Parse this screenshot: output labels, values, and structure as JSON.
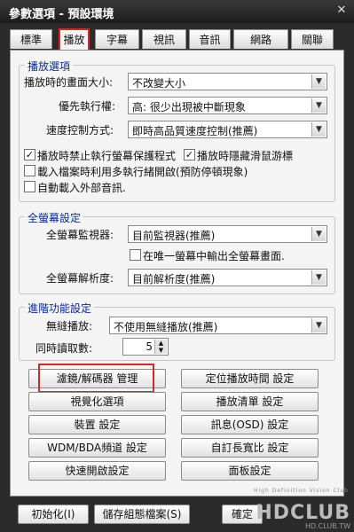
{
  "window": {
    "title": "參數選項 - 預設環境",
    "close_glyph": "✕"
  },
  "tabs": [
    "標準",
    "播放",
    "字幕",
    "視訊",
    "音訊",
    "網路",
    "關聯"
  ],
  "playback_options": {
    "legend": "播放選項",
    "screen_size_label": "播放時的畫面大小:",
    "screen_size_value": "不改變大小",
    "priority_label": "優先執行權:",
    "priority_value": "高: 很少出現被中斷現象",
    "speed_label": "速度控制方式:",
    "speed_value": "即時高品質速度控制(推薦)",
    "checkboxes": [
      {
        "label": "播放時禁止執行螢幕保護程式",
        "checked": true
      },
      {
        "label": "播放時隱藏滑鼠游標",
        "checked": true
      },
      {
        "label": "載入檔案時利用多執行緒開啟(預防停頓現象)",
        "checked": false
      },
      {
        "label": "自動載入外部音訊.",
        "checked": false
      }
    ]
  },
  "fullscreen": {
    "legend": "全螢幕設定",
    "monitor_label": "全螢幕監視器:",
    "monitor_value": "目前監視器(推薦)",
    "single_monitor_label": "在唯一螢幕中輸出全螢幕畫面.",
    "single_monitor_checked": false,
    "resolution_label": "全螢幕解析度:",
    "resolution_value": "目前解析度(推薦)"
  },
  "advanced": {
    "legend": "進階功能設定",
    "seamless_label": "無縫播放:",
    "seamless_value": "不使用無縫播放(推薦)",
    "concurrent_label": "同時讀取數:",
    "concurrent_value": "5"
  },
  "buttons": [
    "濾鏡/解碼器 管理",
    "定位播放時間 設定",
    "視覺化選項",
    "播放清單 設定",
    "裝置 設定",
    "訊息(OSD) 設定",
    "WDM/BDA頻道 設定",
    "自訂長寬比 設定",
    "快速開啟設定",
    "面板設定"
  ],
  "footer": {
    "init_label": "初始化(I)",
    "save_label": "儲存組態檔案(S)",
    "ok_label": "確定"
  },
  "watermark": {
    "brand": "HDCLUB",
    "url": "HD.CLUB.TW",
    "tagline": "High Definition Vision Club"
  }
}
